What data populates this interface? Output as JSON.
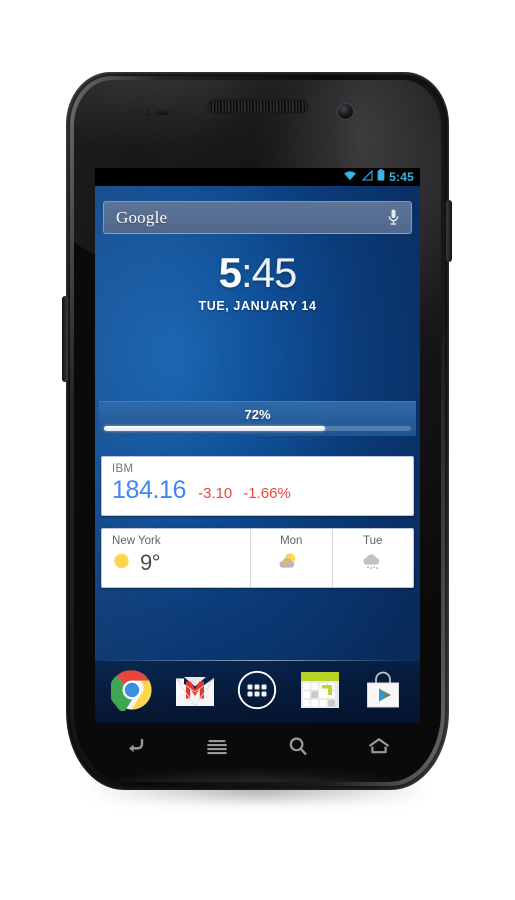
{
  "device": {
    "name": "android-phone",
    "hardware": {
      "earpiece": "earpiece-speaker",
      "front_camera": "front-camera",
      "proximity_sensor": "proximity-sensor",
      "power_button": "power-button",
      "volume_button": "volume-rocker"
    }
  },
  "statusbar": {
    "wifi_icon": "wifi-icon",
    "signal_icon": "signal-icon",
    "battery_icon": "battery-icon",
    "clock": "5:45",
    "accent_color": "#37b4e4"
  },
  "search_widget": {
    "logo_text": "Google",
    "mic_icon": "microphone-icon"
  },
  "clock_widget": {
    "hour": "5",
    "separator": ":",
    "minute": "45",
    "date": "TUE, JANUARY 14"
  },
  "progress_widget": {
    "label": "72%",
    "percent": 72,
    "fill_color": "#ffffff",
    "track_color": "#1e5490"
  },
  "stock_widget": {
    "symbol": "IBM",
    "price": "184.16",
    "change": "-3.10",
    "change_percent": "-1.66%",
    "price_color": "#4285f4",
    "change_color": "#e8453c"
  },
  "weather_widget": {
    "city": "New York",
    "current_temp": "9°",
    "current_icon": "sunny-icon",
    "forecast": [
      {
        "day": "Mon",
        "icon": "partly-cloudy-icon"
      },
      {
        "day": "Tue",
        "icon": "rain-cloud-icon"
      }
    ]
  },
  "dock": {
    "items": [
      {
        "name": "chrome",
        "icon": "chrome-icon"
      },
      {
        "name": "gmail",
        "icon": "gmail-icon"
      },
      {
        "name": "all-apps",
        "icon": "app-drawer-icon"
      },
      {
        "name": "calendar",
        "icon": "calendar-icon"
      },
      {
        "name": "play-store",
        "icon": "play-store-icon"
      }
    ]
  },
  "navbar": {
    "buttons": [
      {
        "name": "back",
        "icon": "back-icon"
      },
      {
        "name": "menu",
        "icon": "menu-icon"
      },
      {
        "name": "search",
        "icon": "search-icon"
      },
      {
        "name": "home",
        "icon": "home-icon"
      }
    ]
  }
}
